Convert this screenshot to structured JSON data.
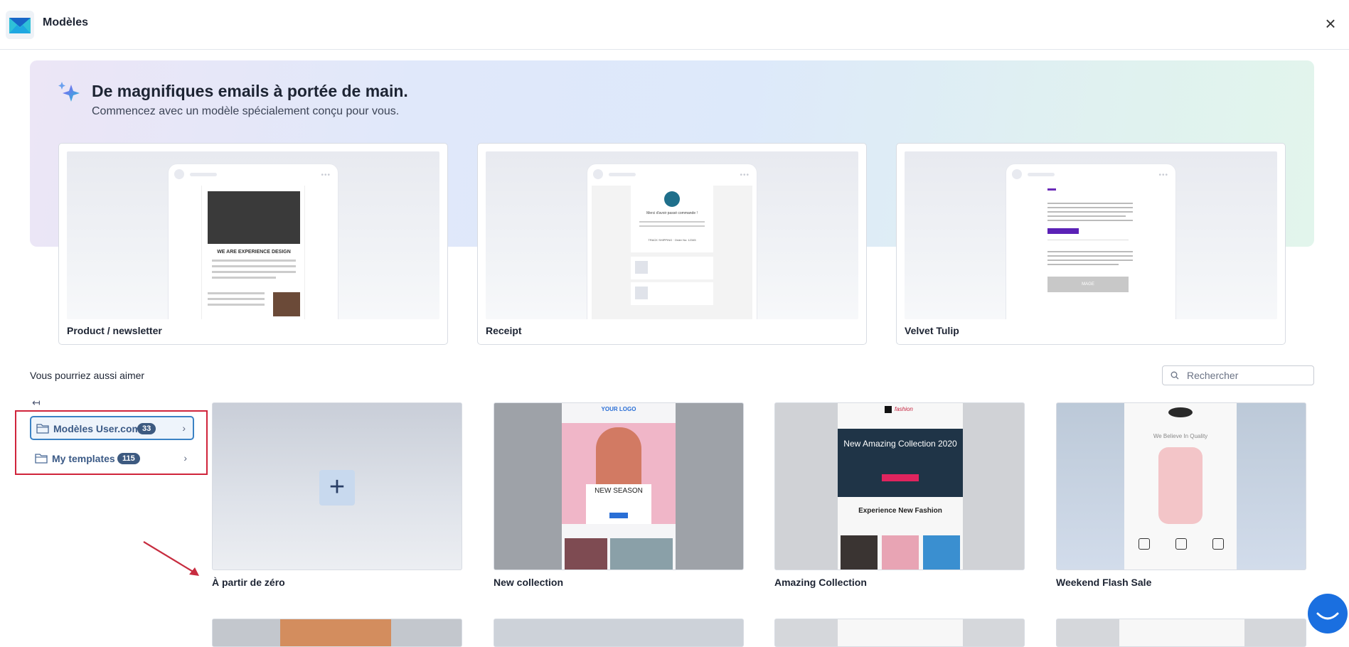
{
  "header": {
    "title": "Modèles",
    "close_icon": "×"
  },
  "hero": {
    "title": "De magnifiques emails à portée de main.",
    "subtitle": "Commencez avec un modèle spécialement conçu pour vous.",
    "sparkle_icon": "sparkle-icon"
  },
  "featured": [
    {
      "label": "Product / newsletter",
      "preview": {
        "title": "WE ARE EXPERIENCE DESIGN"
      }
    },
    {
      "label": "Receipt",
      "preview": {
        "title": "Merci d'avoir passé commande !",
        "line": "TRACK SHIPPING · Order No: 12345"
      }
    },
    {
      "label": "Velvet Tulip",
      "preview": {
        "button": "MAGE"
      }
    }
  ],
  "section": {
    "title": "Vous pourriez aussi aimer"
  },
  "search": {
    "placeholder": "Rechercher"
  },
  "sidebar": {
    "collapse_icon": "↤",
    "items": [
      {
        "label": "Modèles User.com",
        "count": "33",
        "chevron": "›"
      },
      {
        "label": "My templates",
        "count": "115",
        "chevron": "›"
      }
    ]
  },
  "templates": [
    {
      "label": "À partir de zéro",
      "icon": "+"
    },
    {
      "label": "New collection",
      "preview": {
        "logo": "YOUR LOGO",
        "headline": "NEW SEASON"
      }
    },
    {
      "label": "Amazing Collection",
      "preview": {
        "brand": "fashion",
        "headline": "New Amazing Collection 2020",
        "sub": "Experience New Fashion"
      }
    },
    {
      "label": "Weekend Flash Sale",
      "preview": {
        "tagline": "We Believe In Quality"
      }
    }
  ],
  "colors": {
    "accent": "#3b82c4",
    "highlight_box": "#d0243b",
    "badge": "#3d5a80",
    "chat": "#1a6fe0"
  }
}
